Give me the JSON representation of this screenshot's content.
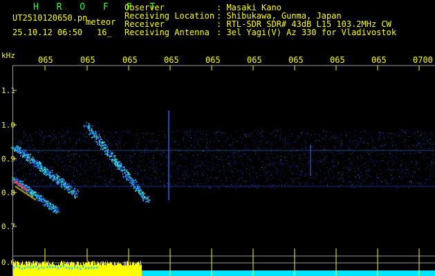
{
  "app": {
    "title": "H R O F F T",
    "filename": "UT2510120650.pn",
    "subtitle": "meteor",
    "datetime": "25.10.12 06:50",
    "seq": "16_"
  },
  "info": {
    "rows": [
      {
        "label": "Observer",
        "value": ": Masaki Kano"
      },
      {
        "label": "Receiving Location",
        "value": ": Shibukawa, Gunma, Japan"
      },
      {
        "label": "Receiver",
        "value": ": RTL-SDR SDR# 43dB L15 103.2MHz CW"
      },
      {
        "label": "Receiving Antenna",
        "value": ": 3el Yagi(V) Az 330 for Vladivostok"
      }
    ]
  },
  "time_axis": {
    "labels": [
      "065",
      "065",
      "065",
      "065",
      "065",
      "065",
      "065",
      "065",
      "065",
      "0700"
    ]
  },
  "freq_axis": {
    "unit": "kHz",
    "labels": [
      "1.1",
      "1.0",
      "0.9",
      "0.8",
      "0.7",
      "0.6"
    ]
  },
  "colors": {
    "header_text": "#ffff00",
    "title_text": "#33ff33",
    "grid": "#9a9a9a",
    "marker": "#ffff00",
    "level_yellow": "#ffff00",
    "level_cyan": "#00e5ff"
  }
}
